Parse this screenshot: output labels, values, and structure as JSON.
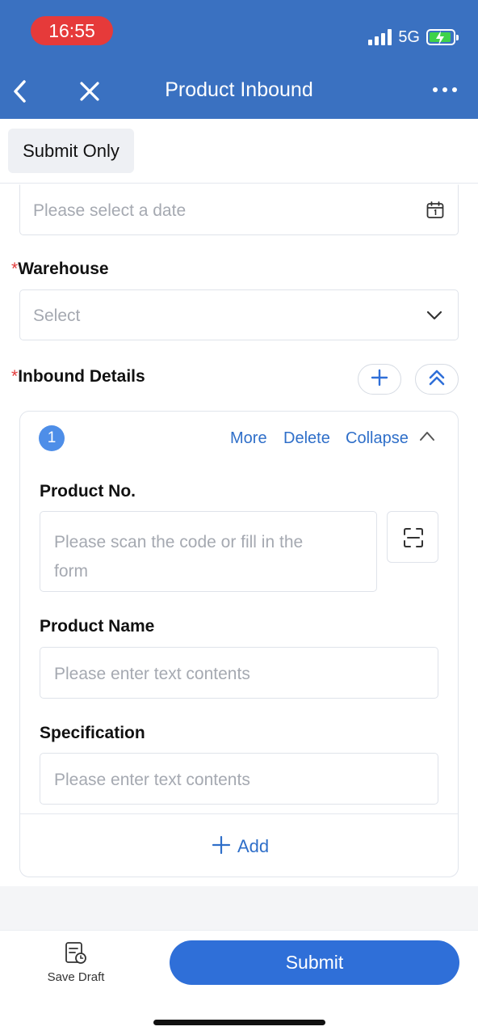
{
  "status_bar": {
    "time": "16:55",
    "network": "5G"
  },
  "nav": {
    "title": "Product Inbound"
  },
  "toolbar": {
    "submit_only_label": "Submit Only"
  },
  "form": {
    "date_field": {
      "placeholder": "Please select a date"
    },
    "warehouse": {
      "label": "Warehouse",
      "required_mark": "*",
      "placeholder": "Select"
    },
    "inbound_details": {
      "label": "Inbound Details",
      "required_mark": "*",
      "item": {
        "index": "1",
        "actions": {
          "more": "More",
          "delete": "Delete",
          "collapse": "Collapse"
        },
        "product_no": {
          "label": "Product No.",
          "placeholder_line1": "Please scan the code or fill in the",
          "placeholder_line2": "form"
        },
        "product_name": {
          "label": "Product Name",
          "placeholder": "Please enter text contents"
        },
        "specification": {
          "label": "Specification",
          "placeholder": "Please enter text contents"
        }
      },
      "add_label": "Add"
    }
  },
  "footer": {
    "save_draft_label": "Save Draft",
    "submit_label": "Submit"
  },
  "colors": {
    "header": "#3a71c1",
    "accent": "#2f6fd8",
    "link": "#2f6fc9",
    "required": "#e23b3b",
    "badge": "#4e8ee8"
  }
}
